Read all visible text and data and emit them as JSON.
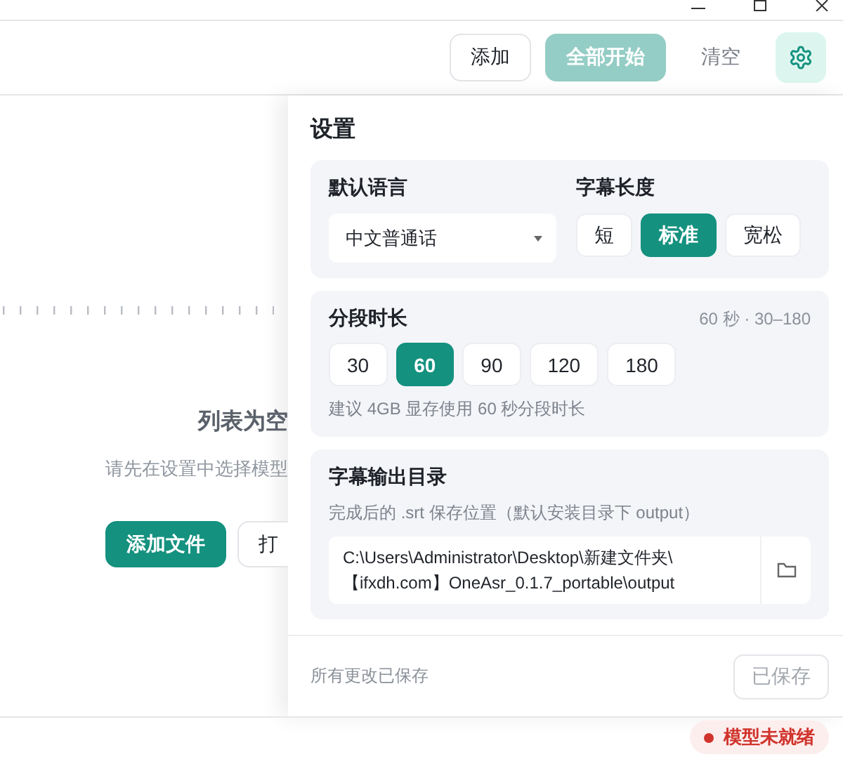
{
  "toolbar": {
    "buttons": [
      {
        "label": "添加",
        "kind": "outline",
        "disabled": false
      },
      {
        "label": "全部开始",
        "kind": "primary",
        "disabled": true
      },
      {
        "label": "清空",
        "kind": "text",
        "disabled": false
      }
    ],
    "settings_button": {
      "selected": true
    }
  },
  "main": {
    "empty_title": "列表为空",
    "empty_hint": "请先在设置中选择模型",
    "buttons": [
      {
        "label": "添加文件",
        "kind": "primary"
      },
      {
        "label": "打",
        "kind": "outline"
      }
    ]
  },
  "settings": {
    "title": "设置",
    "language": {
      "label": "默认语言",
      "value": "中文普通话"
    },
    "subtitle_length": {
      "label": "字幕长度",
      "options": [
        {
          "label": "短",
          "selected": false
        },
        {
          "label": "标准",
          "selected": true
        },
        {
          "label": "宽松",
          "selected": false
        }
      ]
    },
    "segment": {
      "label": "分段时长",
      "reading": "60 秒 · 30–180",
      "options": [
        {
          "label": "30",
          "selected": false
        },
        {
          "label": "60",
          "selected": true
        },
        {
          "label": "90",
          "selected": false
        },
        {
          "label": "120",
          "selected": false
        },
        {
          "label": "180",
          "selected": false
        }
      ],
      "hint": "建议 4GB 显存使用 60 秒分段时长"
    },
    "output": {
      "label": "字幕输出目录",
      "hint": "完成后的 .srt 保存位置（默认安装目录下 output）",
      "path": "C:\\Users\\Administrator\\Desktop\\新建文件夹\\\n【ifxdh.com】OneAsr_0.1.7_portable\\output"
    },
    "footer": {
      "status": "所有更改已保存",
      "save_button": {
        "label": "已保存",
        "disabled": true
      }
    }
  },
  "status_bar": {
    "model_status": "模型未就绪"
  }
}
